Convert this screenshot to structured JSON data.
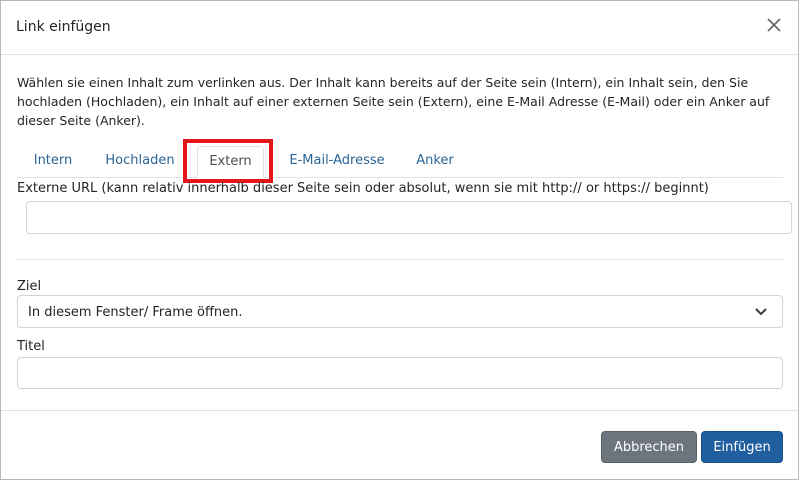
{
  "dialog": {
    "title": "Link einfügen",
    "description": "Wählen sie einen Inhalt zum verlinken aus. Der Inhalt kann bereits auf der Seite sein (Intern), ein Inhalt sein, den Sie hochladen (Hochladen), ein Inhalt auf einer externen Seite sein (Extern), eine E-Mail Adresse (E-Mail) oder ein Anker auf dieser Seite (Anker)."
  },
  "tabs": [
    {
      "label": "Intern"
    },
    {
      "label": "Hochladen"
    },
    {
      "label": "Extern",
      "active": true
    },
    {
      "label": "E-Mail-Adresse"
    },
    {
      "label": "Anker"
    }
  ],
  "external": {
    "url_label": "Externe URL (kann relativ innerhalb dieser Seite sein oder absolut, wenn sie mit http:// or https:// beginnt)",
    "url_value": ""
  },
  "target": {
    "label": "Ziel",
    "selected": "In diesem Fenster/ Frame öffnen."
  },
  "title_field": {
    "label": "Titel",
    "value": ""
  },
  "buttons": {
    "cancel": "Abbrechen",
    "insert": "Einfügen"
  },
  "colors": {
    "link": "#2a6496",
    "highlight": "#e4161c",
    "primary": "#1f5fa0",
    "secondary": "#6c757d"
  },
  "icons": {
    "close": "close-icon",
    "dropdown": "chevron-down-icon"
  }
}
